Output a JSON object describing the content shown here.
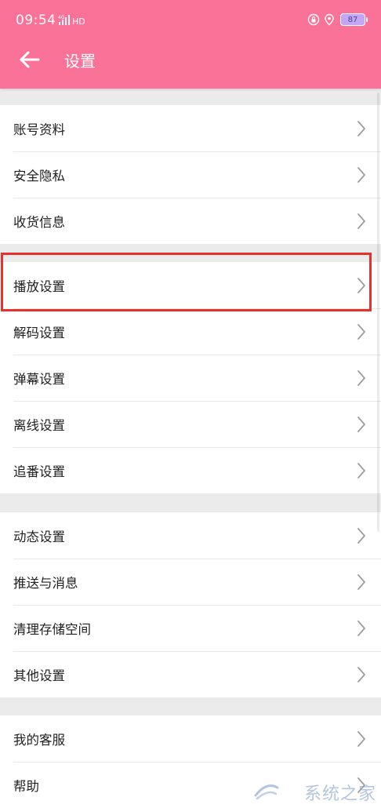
{
  "status_bar": {
    "time": "09:54",
    "signal_label": "4G",
    "hd_label": "HD",
    "battery": "87"
  },
  "header": {
    "title": "设置",
    "back_icon": "arrow-left-icon",
    "background": "#fb7299"
  },
  "groups": [
    {
      "items": [
        {
          "label": "账号资料"
        },
        {
          "label": "安全隐私"
        },
        {
          "label": "收货信息"
        }
      ]
    },
    {
      "items": [
        {
          "label": "播放设置"
        },
        {
          "label": "解码设置"
        },
        {
          "label": "弹幕设置"
        },
        {
          "label": "离线设置"
        },
        {
          "label": "追番设置"
        }
      ]
    },
    {
      "items": [
        {
          "label": "动态设置"
        },
        {
          "label": "推送与消息"
        },
        {
          "label": "清理存储空间"
        },
        {
          "label": "其他设置"
        }
      ]
    },
    {
      "items": [
        {
          "label": "我的客服"
        },
        {
          "label": "帮助"
        }
      ]
    }
  ],
  "highlight": {
    "target": "播放设置",
    "color": "#e8302f"
  },
  "watermark": {
    "text": "系统之家"
  }
}
